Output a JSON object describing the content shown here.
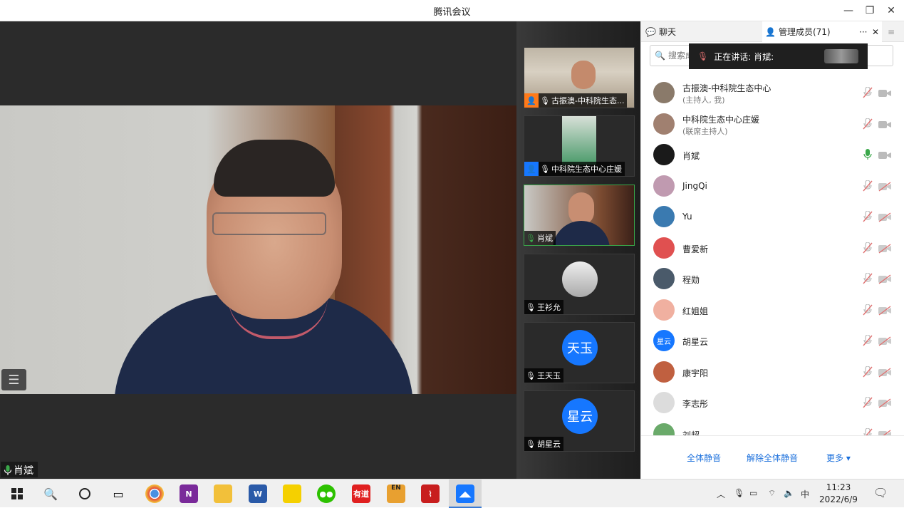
{
  "window": {
    "title": "腾讯会议",
    "minimize": "—",
    "restore": "❐",
    "close": "✕"
  },
  "main_video": {
    "speaker_name": "肖斌"
  },
  "video_strip": [
    {
      "name": "古振澳-中科院生态...",
      "role": "host"
    },
    {
      "name": "中科院生态中心庄媛",
      "role": "cohost"
    },
    {
      "name": "肖斌",
      "role": "speaking"
    },
    {
      "name": "王衫允",
      "role": "none"
    },
    {
      "name": "王天玉",
      "role": "none",
      "avatar": "天玉"
    },
    {
      "name": "胡星云",
      "role": "none",
      "avatar": "星云"
    }
  ],
  "side_panel": {
    "tab_chat": "聊天",
    "tab_members": "管理成员(71)",
    "more": "···",
    "close": "✕",
    "menu": "≡",
    "search_placeholder": "搜索成",
    "speaking_label": "正在讲话: 肖斌:",
    "members": [
      {
        "name": "古振澳-中科院生态中心",
        "sub": "(主持人, 我)",
        "mic": "muted",
        "cam": "on"
      },
      {
        "name": "中科院生态中心庄媛",
        "sub": "(联席主持人)",
        "mic": "muted",
        "cam": "on"
      },
      {
        "name": "肖斌",
        "sub": "",
        "mic": "active",
        "cam": "on"
      },
      {
        "name": "JingQi",
        "sub": "",
        "mic": "muted",
        "cam": "off"
      },
      {
        "name": "Yu",
        "sub": "",
        "mic": "muted",
        "cam": "off"
      },
      {
        "name": "曹爱新",
        "sub": "",
        "mic": "muted",
        "cam": "off"
      },
      {
        "name": "程勋",
        "sub": "",
        "mic": "muted",
        "cam": "off"
      },
      {
        "name": "红姐姐",
        "sub": "",
        "mic": "muted",
        "cam": "off"
      },
      {
        "name": "胡星云",
        "sub": "",
        "mic": "muted",
        "cam": "off",
        "avatar": "星云"
      },
      {
        "name": "康宇阳",
        "sub": "",
        "mic": "muted",
        "cam": "off"
      },
      {
        "name": "李志彤",
        "sub": "",
        "mic": "muted",
        "cam": "off"
      },
      {
        "name": "刘超",
        "sub": "",
        "mic": "muted",
        "cam": "off"
      }
    ],
    "footer": {
      "mute_all": "全体静音",
      "unmute_all": "解除全体静音",
      "more": "更多 ▾"
    }
  },
  "taskbar": {
    "apps": [
      "chrome",
      "onenote",
      "file-explorer",
      "word",
      "sticky-notes",
      "wechat",
      "youdao",
      "en-dict",
      "acrobat",
      "tencent-meeting"
    ],
    "youdao_label": "有道",
    "en_label": "EN",
    "ime": "中",
    "time": "11:23",
    "date": "2022/6/9"
  },
  "colors": {
    "accent": "#1a6fdc",
    "mic_active": "#3aa84a",
    "muted": "#e07070",
    "avatar_blue": "#1677ff"
  }
}
